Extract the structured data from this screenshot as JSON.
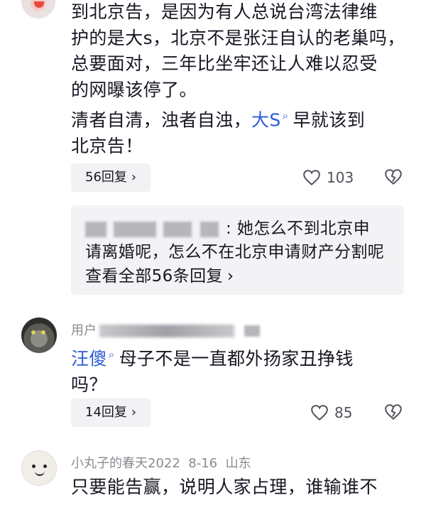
{
  "comments": [
    {
      "lines": [
        "到北京告，是因为有人总说台湾法律维",
        "护的是大s，北京不是张汪自认的老巢吗，",
        "总要面对，三年比坐牢还让人难以忍受",
        "的网曝该停了。"
      ],
      "line5_before": " 清者自清，浊者自浊，",
      "line5_mention": "大S",
      "line5_after": "早就该到",
      "line6": "北京告！",
      "replies_label": "56回复",
      "likes": "103",
      "reply_preview": {
        "line1": ":  她怎么不到北京申",
        "line2": "请离婚呢，怎么不在北京申请财产分割呢",
        "view_all": "查看全部56条回复"
      }
    },
    {
      "username_prefix": "用户",
      "mention": "汪傻",
      "line1_after": "母子不是一直都外扬家丑挣钱",
      "line2": "吗？",
      "replies_label": "14回复",
      "likes": "85"
    },
    {
      "username": "小丸子的春天2022",
      "date": "8-16",
      "location": "山东",
      "line1": "只要能告赢，说明人家占理，谁输谁不"
    }
  ],
  "icons": {
    "chevron": "chevron-right-icon",
    "like": "heart-icon",
    "dislike": "broken-heart-icon",
    "mention": "search-icon"
  },
  "colors": {
    "mention": "#2e5bd6",
    "muted": "#8a8b91",
    "chip_bg": "#f2f2f4"
  }
}
